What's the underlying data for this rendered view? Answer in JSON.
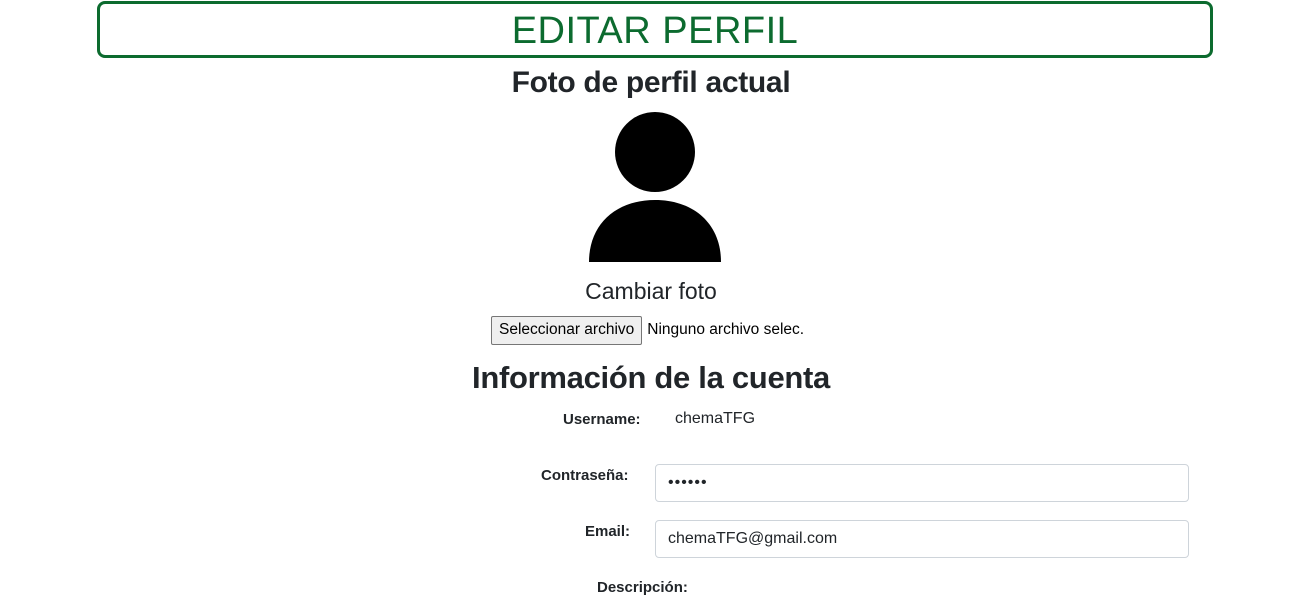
{
  "header": {
    "title": "EDITAR PERFIL",
    "accent_color": "#0c6b2f"
  },
  "profile_photo": {
    "heading": "Foto de perfil actual",
    "avatar_icon": "person-silhouette-icon",
    "change_label": "Cambiar foto",
    "file_button_label": "Seleccionar archivo",
    "file_status": "Ninguno archivo selec."
  },
  "account": {
    "heading": "Información de la cuenta",
    "username_label": "Username:",
    "username_value": "chemaTFG",
    "password_label": "Contraseña:",
    "password_value": "••••••",
    "email_label": "Email:",
    "email_value": "chemaTFG@gmail.com",
    "description_label": "Descripción:"
  }
}
